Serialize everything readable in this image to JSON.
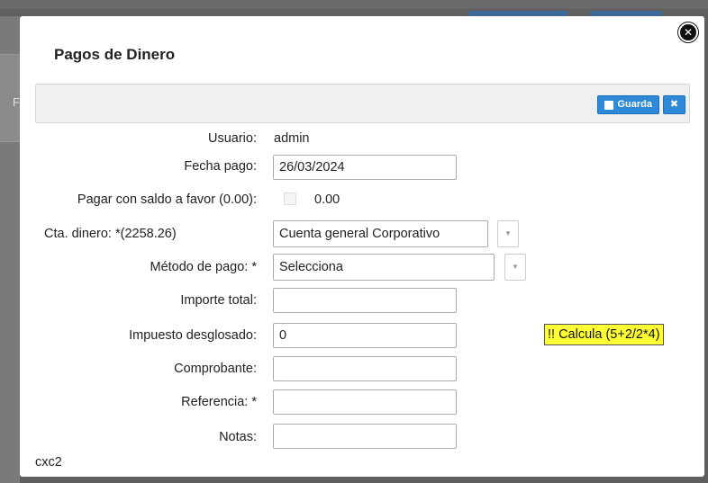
{
  "modal": {
    "title": "Pagos de Dinero",
    "close_icon": "close-circle-icon",
    "close_glyph": "✕"
  },
  "background": {
    "letter": "F"
  },
  "toolbar": {
    "save_label": "Guarda",
    "save_icon": "square-icon",
    "close_glyph": "✖"
  },
  "form": {
    "usuario_label": "Usuario:",
    "usuario_value": "admin",
    "fecha_label": "Fecha pago:",
    "fecha_value": "26/03/2024",
    "saldo_label": "Pagar con saldo a favor (0.00):",
    "saldo_value": "0.00",
    "cta_label": "Cta. dinero:  *(2258.26)",
    "cta_value": "Cuenta general Corporativo",
    "metodo_label": "Método de pago:  *",
    "metodo_value": "Selecciona",
    "importe_label": "Importe total:",
    "importe_value": "",
    "impuesto_label": "Impuesto desglosado:",
    "impuesto_value": "0",
    "calcula_label": "!! Calcula (5+2/2*4)",
    "comprobante_label": "Comprobante:",
    "comprobante_value": "",
    "referencia_label": "Referencia: *",
    "referencia_value": "",
    "notas_label": "Notas:",
    "notas_value": ""
  },
  "footer": {
    "code": "cxc2"
  },
  "colors": {
    "button_blue": "#2e8ad8",
    "highlight_yellow": "#ffff33",
    "overlay": "#5f5f5f"
  }
}
